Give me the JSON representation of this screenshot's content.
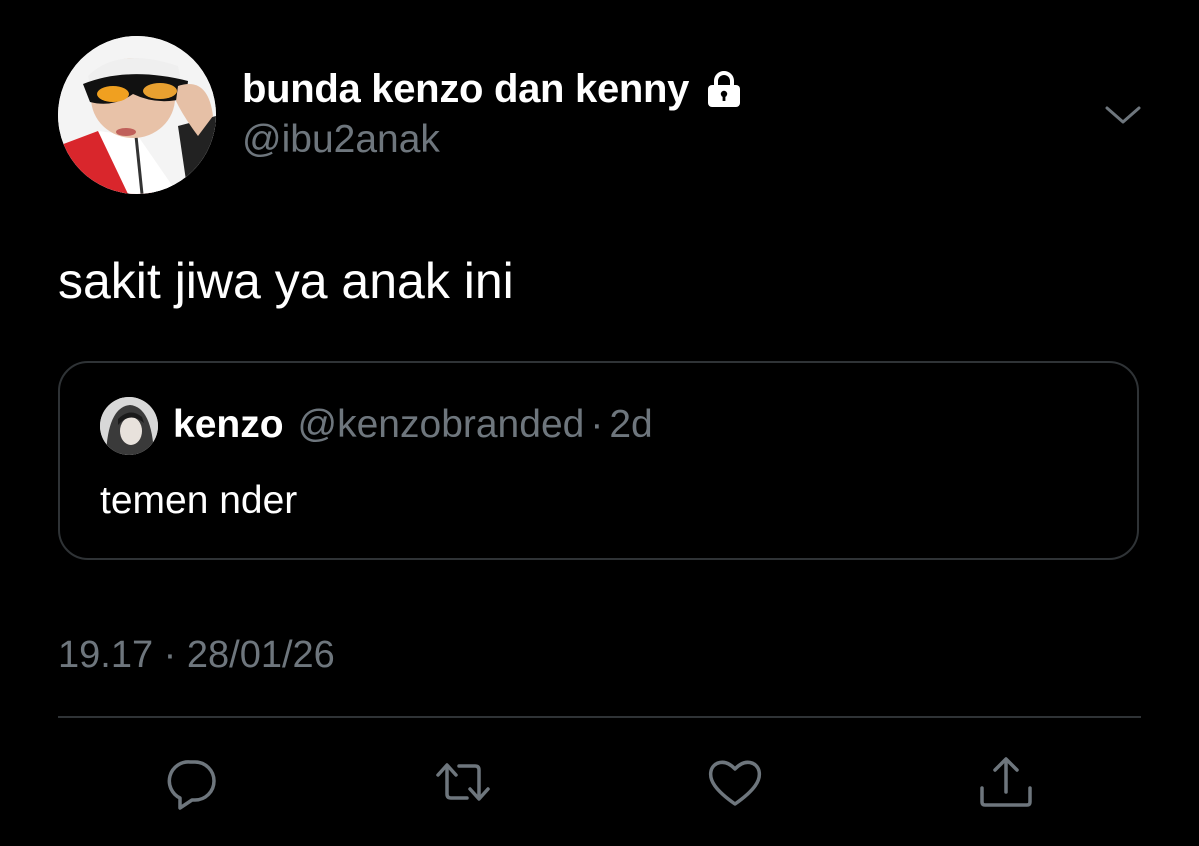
{
  "tweet": {
    "author": {
      "display_name": "bunda kenzo dan kenny",
      "handle": "@ibu2anak",
      "protected_icon": "lock-icon"
    },
    "text": "sakit jiwa ya anak ini",
    "quoted": {
      "display_name": "kenzo",
      "handle": "@kenzobranded",
      "separator": "·",
      "age": "2d",
      "text": "temen nder"
    },
    "timestamp": "19.17 · 28/01/26",
    "actions": [
      {
        "icon": "reply-icon"
      },
      {
        "icon": "retweet-icon"
      },
      {
        "icon": "like-icon"
      },
      {
        "icon": "share-icon"
      }
    ],
    "menu_icon": "chevron-down-icon"
  },
  "colors": {
    "background": "#000000",
    "text_primary": "#ffffff",
    "text_secondary": "#6e767d",
    "border": "#2f3336"
  }
}
